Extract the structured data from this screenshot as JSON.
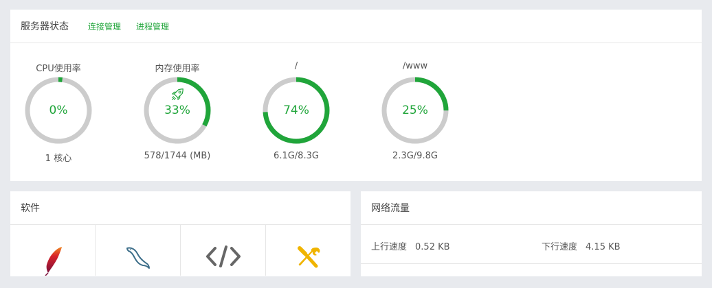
{
  "status_panel": {
    "title": "服务器状态",
    "links": [
      "连接管理",
      "进程管理"
    ],
    "gauges": [
      {
        "label": "CPU使用率",
        "value": "0%",
        "percent": 0.02,
        "detail": "1 核心"
      },
      {
        "label": "内存使用率",
        "value": "33%",
        "percent": 0.33,
        "detail": "578/1744 (MB)"
      },
      {
        "label": "/",
        "value": "74%",
        "percent": 0.74,
        "detail": "6.1G/8.3G"
      },
      {
        "label": "/www",
        "value": "25%",
        "percent": 0.25,
        "detail": "2.3G/9.8G"
      }
    ]
  },
  "software_panel": {
    "title": "软件",
    "items": [
      {
        "icon": "apache-feather-icon"
      },
      {
        "icon": "mysql-dolphin-icon"
      },
      {
        "icon": "code-brackets-icon"
      },
      {
        "icon": "tools-icon"
      }
    ]
  },
  "network_panel": {
    "title": "网络流量",
    "upload_label": "上行速度",
    "upload_value": "0.52 KB",
    "download_label": "下行速度",
    "download_value": "4.15 KB"
  },
  "colors": {
    "accent": "#20a53a",
    "ring_track": "#cccccc",
    "tools_icon": "#f0b400",
    "feather": "#b3122a"
  }
}
